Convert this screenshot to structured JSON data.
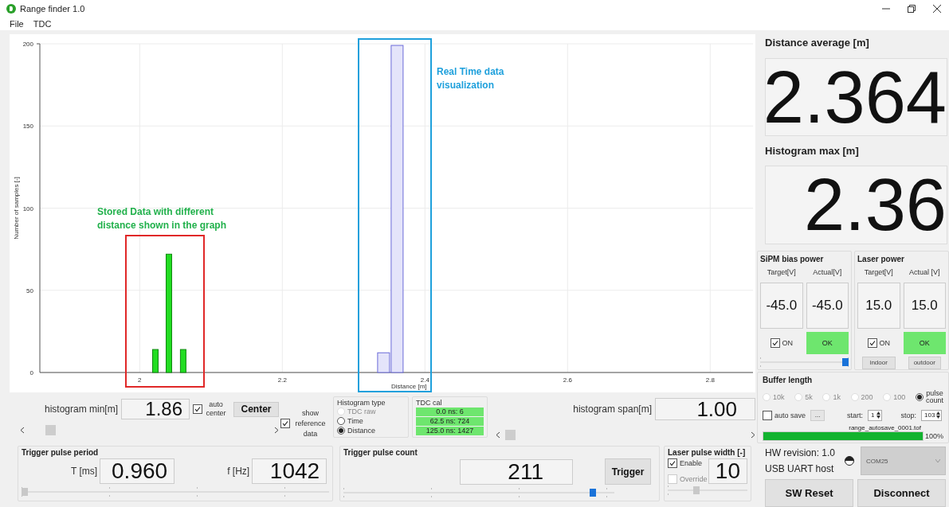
{
  "window": {
    "title": "Range finder 1.0"
  },
  "menu": [
    "File",
    "TDC"
  ],
  "histogram": {
    "chart_data": {
      "type": "bar",
      "xlabel": "Distance [m]",
      "ylabel": "Number of samples [-]",
      "x": [
        2.022,
        2.041,
        2.061,
        2.342,
        2.361
      ],
      "series": [
        {
          "color": "#22dd22",
          "values": [
            14,
            72,
            14,
            null,
            null
          ]
        },
        {
          "color": "#e4e4fa",
          "values": [
            null,
            null,
            null,
            12,
            199
          ]
        }
      ],
      "xlim": [
        1.86,
        2.86
      ],
      "ylim": [
        0,
        200
      ],
      "xticks": [
        2,
        2.2,
        2.4,
        2.6,
        2.8
      ],
      "yticks": [
        0,
        50,
        100,
        150,
        200
      ],
      "grid": true
    },
    "callouts": [
      {
        "text": "Stored Data with different distance shown in the graph",
        "color": "#22b14c"
      },
      {
        "text": "Real Time data visualization",
        "color": "#1ea0dc"
      }
    ]
  },
  "histogram_min": {
    "label": "histogram min[m]",
    "value": "1.86"
  },
  "auto_center": {
    "label": "auto center",
    "checked": true
  },
  "center_button": "Center",
  "show_reference": {
    "label": "show reference data",
    "checked": true
  },
  "histogram_type": {
    "title": "Histogram type",
    "options": [
      {
        "label": "TDC raw",
        "selected": false,
        "disabled": true
      },
      {
        "label": "Time",
        "selected": false,
        "disabled": false
      },
      {
        "label": "Distance",
        "selected": true,
        "disabled": false
      }
    ]
  },
  "tdc_cal": {
    "title": "TDC cal",
    "rows": [
      "0.0 ns: 6",
      "62.5 ns: 724",
      "125.0 ns: 1427"
    ]
  },
  "histogram_span": {
    "label": "histogram span[m]",
    "value": "1.00"
  },
  "trigger_period": {
    "title": "Trigger pulse period",
    "period_label": "T [ms]",
    "period": "0.960",
    "freq_label": "f [Hz]",
    "freq": "1042",
    "slider": {
      "level": 0
    }
  },
  "trigger_count": {
    "title": "Trigger pulse count",
    "value": "211",
    "button": "Trigger",
    "slider": {
      "level": 0.93
    }
  },
  "laser_pulse_width": {
    "title": "Laser pulse width [-]",
    "enable": {
      "label": "Enable",
      "checked": true
    },
    "override": {
      "label": "Override",
      "checked": false,
      "disabled": true
    },
    "value": "10",
    "slider": {
      "level": 0.35
    }
  },
  "distance_average": {
    "label": "Distance average [m]",
    "value": "2.364"
  },
  "histogram_max": {
    "label": "Histogram max [m]",
    "value": "2.36"
  },
  "sipm_bias": {
    "title": "SiPM bias power",
    "target_label": "Target[V]",
    "actual_label": "Actual[V]",
    "target": "-45.0",
    "actual": "-45.0",
    "on": {
      "label": "ON",
      "checked": true
    },
    "status": "OK",
    "slider": {
      "level": 1
    }
  },
  "laser_power": {
    "title": "Laser power",
    "target_label": "Target[V]",
    "actual_label": "Actual [V]",
    "target": "15.0",
    "actual": "15.0",
    "on": {
      "label": "ON",
      "checked": true
    },
    "status": "OK",
    "modes": [
      "indoor",
      "outdoor"
    ]
  },
  "buffer_length": {
    "title": "Buffer length",
    "options": [
      {
        "label": "10k",
        "selected": false,
        "disabled": true
      },
      {
        "label": "5k",
        "selected": false,
        "disabled": true
      },
      {
        "label": "1k",
        "selected": false,
        "disabled": true
      },
      {
        "label": "200",
        "selected": false,
        "disabled": true
      },
      {
        "label": "100",
        "selected": false,
        "disabled": true
      },
      {
        "label": "pulse count",
        "selected": true,
        "disabled": false
      }
    ],
    "auto_save": {
      "label": "auto save",
      "checked": false
    },
    "browse": "...",
    "start_label": "start:",
    "start": "1",
    "stop_label": "stop:",
    "stop": "103",
    "file": "range_autosave_0001.tof",
    "progress": {
      "level": 1,
      "text": "100%"
    }
  },
  "hw": {
    "revision": "HW revision: 1.0",
    "host": "USB UART host",
    "port": {
      "value": "COM25",
      "disabled": true
    }
  },
  "buttons": [
    "SW Reset",
    "Disconnect"
  ]
}
